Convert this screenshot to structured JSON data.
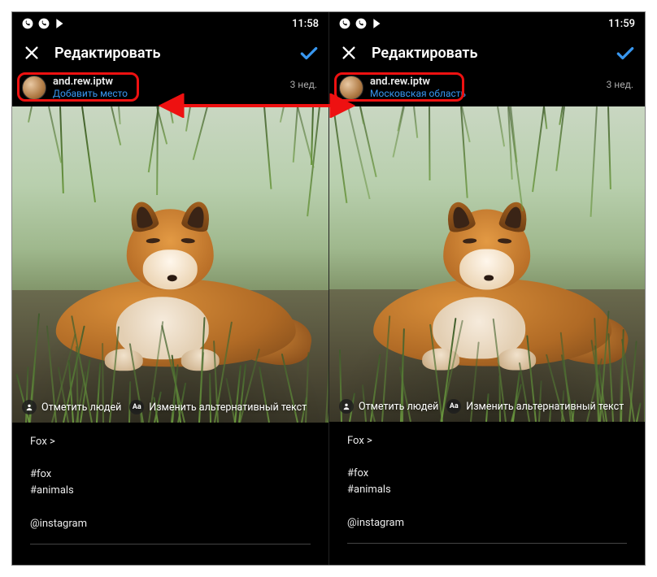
{
  "status": {
    "time_left": "11:58",
    "time_right": "11:59",
    "icons": [
      "viber-icon",
      "viber-icon",
      "play-store-icon"
    ]
  },
  "header": {
    "title": "Редактировать"
  },
  "post": {
    "username": "and.rew.iptw",
    "age": "3 нед.",
    "location_left": "Добавить место",
    "location_right": "Московская область",
    "tags": {
      "people": "Отметить людей",
      "alt": "Изменить альтернативный текст",
      "alt_badge": "Aa"
    },
    "caption": "Fox >\n\n#fox\n#animals\n\n@instagram"
  },
  "colors": {
    "accent": "#3897f0",
    "annot": "#e11"
  }
}
